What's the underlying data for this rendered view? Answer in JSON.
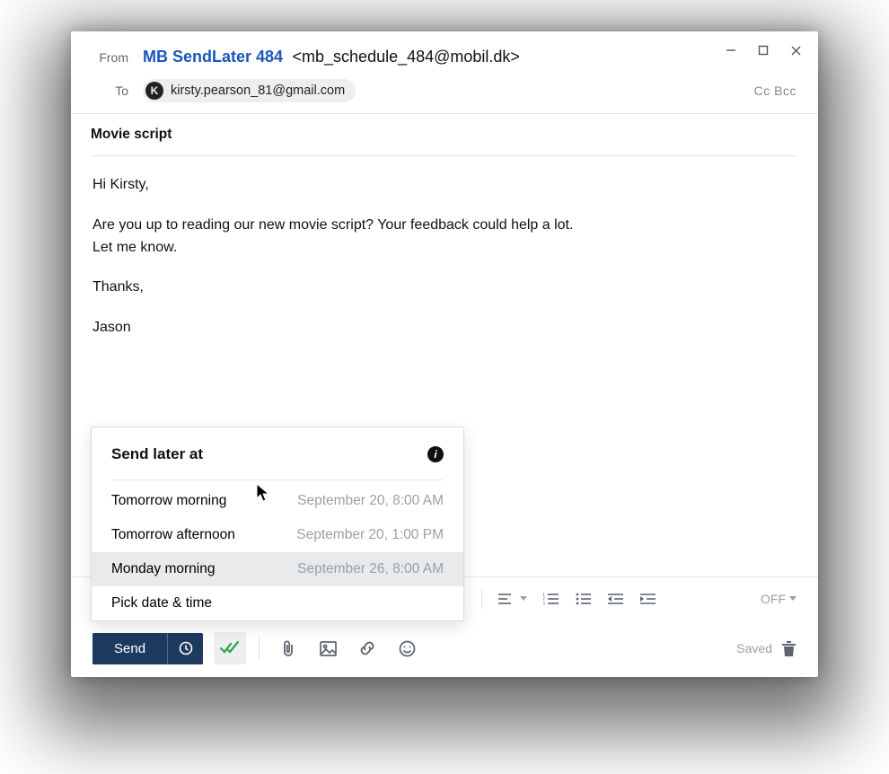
{
  "from": {
    "label": "From",
    "name": "MB SendLater 484",
    "address": "<mb_schedule_484@mobil.dk>"
  },
  "to": {
    "label": "To",
    "recipient_initial": "K",
    "recipient_email": "kirsty.pearson_81@gmail.com",
    "ccbcc": "Cc Bcc"
  },
  "subject": "Movie script",
  "body": {
    "greeting": "Hi Kirsty,",
    "para": "Are you up to reading our new movie script? Your feedback could help a lot.\nLet me know.",
    "thanks": "Thanks,",
    "sign": "Jason"
  },
  "popup": {
    "title": "Send later at",
    "options": [
      {
        "label": "Tomorrow morning",
        "when": "September 20, 8:00 AM",
        "hover": false
      },
      {
        "label": "Tomorrow afternoon",
        "when": "September 20, 1:00 PM",
        "hover": false
      },
      {
        "label": "Monday morning",
        "when": "September 26, 8:00 AM",
        "hover": true
      },
      {
        "label": "Pick date & time",
        "when": "",
        "hover": false
      }
    ]
  },
  "toolbar": {
    "send": "Send",
    "saved": "Saved",
    "off": "OFF"
  }
}
